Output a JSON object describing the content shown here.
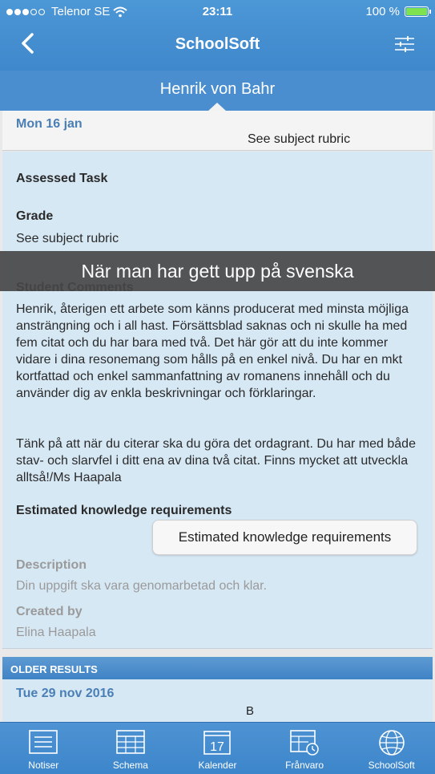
{
  "status_bar": {
    "carrier": "Telenor SE",
    "time": "23:11",
    "battery_percent": "100 %",
    "signal_bars": 3,
    "signal_total": 5
  },
  "nav": {
    "title": "SchoolSoft"
  },
  "student": {
    "name": "Henrik von Bahr"
  },
  "current_result": {
    "date": "Mon 16 jan",
    "value": "See subject rubric"
  },
  "detail": {
    "assessed_task_label": "Assessed Task",
    "grade_label": "Grade",
    "grade_value": "See subject rubric",
    "student_comments_label": "Student Comments",
    "comment_paragraph_1": "Henrik, återigen ett arbete som känns producerat med minsta möjliga ansträngning och i all hast. Försättsblad saknas och ni skulle ha med fem citat och du har bara med två. Det här gör att du inte kommer vidare i dina resonemang som hålls på en enkel nivå. Du har en mkt kortfattad och enkel sammanfattning av romanens innehåll och du använder dig av enkla beskrivningar och förklaringar.",
    "comment_paragraph_2": "Tänk på att när du citerar ska du göra det ordagrant. Du har med både stav- och slarvfel i ditt ena av dina två citat. Finns mycket att utveckla alltså!/Ms Haapala",
    "ekr_label": "Estimated knowledge requirements",
    "ekr_button": "Estimated knowledge requirements",
    "description_label": "Description",
    "description_value": "Din uppgift ska vara genomarbetad och klar.",
    "created_by_label": "Created by",
    "created_by_value": "Elina Haapala"
  },
  "older_results": {
    "header": "OLDER RESULTS",
    "items": [
      {
        "date": "Tue 29 nov 2016",
        "value": "B"
      }
    ]
  },
  "overlay": {
    "caption": "När man har gett upp på svenska"
  },
  "tabbar": {
    "tabs": [
      {
        "label": "Notiser",
        "icon": "notices-icon"
      },
      {
        "label": "Schema",
        "icon": "schedule-icon"
      },
      {
        "label": "Kalender",
        "icon": "calendar-icon",
        "calendar_day": "17"
      },
      {
        "label": "Frånvaro",
        "icon": "absence-icon"
      },
      {
        "label": "SchoolSoft",
        "icon": "globe-icon"
      }
    ]
  },
  "colors": {
    "brand_blue": "#4a8ed0",
    "date_blue": "#4a7fb6",
    "detail_bg": "#d7e8f5",
    "battery_green": "#7ee34f"
  }
}
